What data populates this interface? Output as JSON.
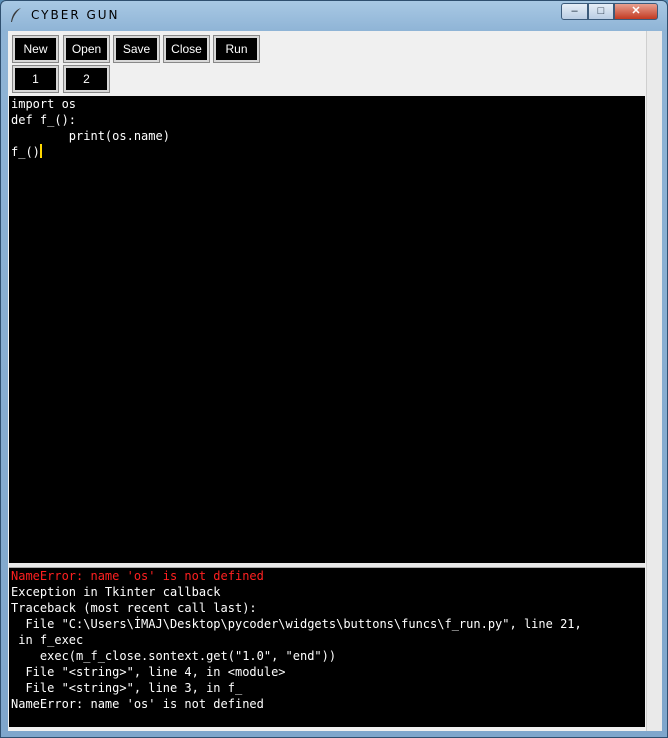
{
  "window": {
    "title": "CYBER GUN",
    "min_glyph": "–",
    "max_glyph": "□",
    "close_glyph": "✕"
  },
  "toolbar": {
    "new_label": "New",
    "open_label": "Open",
    "save_label": "Save",
    "close_label": "Close",
    "run_label": "Run"
  },
  "tabs": {
    "tab1_label": "1",
    "tab2_label": "2"
  },
  "editor": {
    "lines": [
      "import os",
      "def f_():",
      "        print(os.name)",
      "f_()"
    ]
  },
  "console": {
    "lines": [
      "NameError: name 'os' is not defined",
      "Exception in Tkinter callback",
      "Traceback (most recent call last):",
      "  File \"C:\\Users\\İMAJ\\Desktop\\pycoder\\widgets\\buttons\\funcs\\f_run.py\", line 21,",
      " in f_exec",
      "    exec(m_f_close.sontext.get(\"1.0\", \"end\"))",
      "  File \"<string>\", line 4, in <module>",
      "  File \"<string>\", line 3, in f_",
      "NameError: name 'os' is not defined"
    ]
  },
  "colors": {
    "error": "#ff2020",
    "cursor": "#ffd800",
    "editor_bg": "#000000"
  }
}
